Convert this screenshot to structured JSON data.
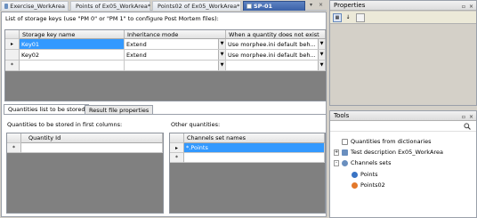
{
  "tabs": [
    {
      "label": "Exercise_WorkArea",
      "active": false,
      "color": "#6a8fbf"
    },
    {
      "label": "Points of Ex05_WorkArea*",
      "active": false,
      "color": "#e39a3a"
    },
    {
      "label": "Points02 of Ex05_WorkArea*",
      "active": false,
      "color": "#e39a3a"
    },
    {
      "label": "SP-01",
      "active": true,
      "color": "#ffffff"
    }
  ],
  "tab_controls": {
    "pin": "▾",
    "close": "×"
  },
  "main": {
    "storage_hint": "List of storage keys (use \"PM 0\" or \"PM 1\" to configure Post Mortem files):",
    "storage_grid": {
      "columns": [
        "Storage key name",
        "Inheritance mode",
        "When a quantity does not exist"
      ],
      "rows": [
        {
          "marker": "▸",
          "name": "Key01",
          "mode": "Extend",
          "missing": "Use morphee.ini default beh...",
          "selected": true
        },
        {
          "marker": "",
          "name": "Key02",
          "mode": "Extend",
          "missing": "Use morphee.ini default beh...",
          "selected": false
        },
        {
          "marker": "*",
          "name": "",
          "mode": "",
          "missing": "",
          "selected": false
        }
      ]
    },
    "subtabs": [
      {
        "label": "Quantities list to be stored",
        "active": true
      },
      {
        "label": "Result file properties",
        "active": false
      }
    ],
    "quantities_label": "Quantities to be stored in first columns:",
    "quantity_grid": {
      "column": "Quantity Id",
      "new_marker": "*"
    },
    "other_label": "Other quantities:",
    "channels_grid": {
      "column": "Channels set names",
      "rows": [
        {
          "marker": "▸",
          "value": "*.Points",
          "selected": true
        },
        {
          "marker": "*",
          "value": "",
          "selected": false
        }
      ]
    }
  },
  "properties": {
    "title": "Properties",
    "controls": {
      "pin": "▫",
      "close": "×"
    }
  },
  "tools": {
    "title": "Tools",
    "controls": {
      "pin": "▫",
      "close": "×"
    },
    "items": [
      {
        "label": "Quantities from dictionaries",
        "icon": "dictionary-icon",
        "color": "#8a8a8a",
        "indent": 0,
        "expander": ""
      },
      {
        "label": "Test description Ex05_WorkArea",
        "icon": "test-icon",
        "color": "#6a8fbf",
        "indent": 0,
        "expander": "+"
      },
      {
        "label": "Channels sets",
        "icon": "channels-icon",
        "color": "#6a8fbf",
        "indent": 0,
        "expander": "-"
      },
      {
        "label": "Points",
        "icon": "points-icon",
        "color": "#3a74c4",
        "indent": 1,
        "expander": ""
      },
      {
        "label": "Points02",
        "icon": "points02-icon",
        "color": "#e3782a",
        "indent": 1,
        "expander": ""
      }
    ]
  }
}
